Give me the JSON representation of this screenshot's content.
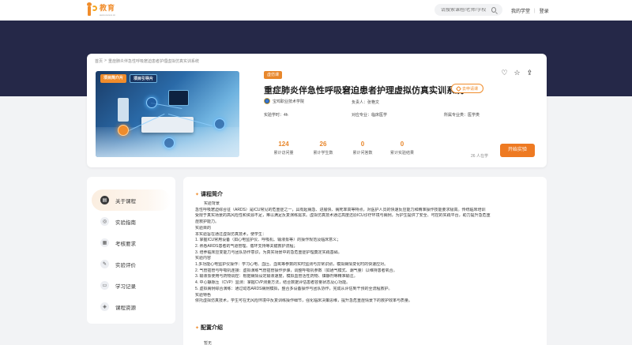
{
  "header": {
    "logo_title": "教育",
    "logo_subtitle": "www.xxxxxx.cn",
    "search_placeholder": "请搜索课程/老师/学校",
    "my_study": "我的学堂",
    "separator": "|",
    "login": "登录"
  },
  "breadcrumb": {
    "home": "首页",
    "arrow": ">",
    "current": "重症肺炎伴急性呼吸窘迫患者护理虚拟仿真实训系统"
  },
  "course": {
    "cover_tags": [
      "项目简介片",
      "项目引导片"
    ],
    "badge": "虚仿课",
    "title": "重症肺炎伴急性呼吸窘迫患者护理虚拟仿真实训系统",
    "apply_label": "去申请课",
    "school": "宝鸡职业技术学院",
    "owner": "负责人：张艳文",
    "hours": "实验学时：4h",
    "major": "对应专业：临床医学",
    "category": "所属专业类：医学类",
    "stats": [
      {
        "value": "124",
        "label": "累计访问量"
      },
      {
        "value": "26",
        "label": "累计学生数"
      },
      {
        "value": "0",
        "label": "累计问答数"
      },
      {
        "value": "0",
        "label": "累计实验结果"
      }
    ],
    "learners": "26 人在学",
    "start_label": "开始实验"
  },
  "side_nav": [
    {
      "label": "关于课程",
      "icon": "course-info-icon",
      "active": true
    },
    {
      "label": "实验指南",
      "icon": "compass-icon",
      "active": false
    },
    {
      "label": "考核要求",
      "icon": "clipboard-icon",
      "active": false
    },
    {
      "label": "实验评价",
      "icon": "pen-icon",
      "active": false
    },
    {
      "label": "学习记录",
      "icon": "book-icon",
      "active": false
    },
    {
      "label": "课程资源",
      "icon": "layers-icon",
      "active": false
    }
  ],
  "intro": {
    "title": "课程简介",
    "lines": [
      "实验背景",
      "急性呼吸窘迫综合征（ARDS）是ICU常见的危重症之一，具有起病急、进展快、病死率高等特点，对医护人员的快速反应能力和精准操作技能要求极高。传统临床培训",
      "受限于真实场景的高风险性和资源不足，难以满足反复演练需求。虚拟仿真技术通过高度还原ICU诊疗环境与病例，为护生提供了安全、可控的实践平台，助力提升急危重",
      "症救护能力。",
      "实验目的",
      "本实验旨在通过虚拟仿真技术，使学生：",
      "1. 掌握ICU常用设备（如心电监护仪、呼吸机、输液泵等）的操作规范及临床意义；",
      "2. 熟悉ARDS患者的气道管理、循环支持等关键救护流程；",
      "3. 培养临床应变能力与团队协作意识，为真实场景中的急危重症护理奠定实践基础。",
      "实验内容",
      "1.多功能心电监护仪操作：学习心电、血压、血氧等参数的实时监测与异常识别，模拟病情变化时的快速应对。",
      "2. 气管插管与呼吸机连接：虚拟演练气管插管操作步骤，调整呼吸机参数（如通气模式、潮气量）以维持患者氧合。",
      "3. 输液泵使用与药物调控：根据病情设定输液速度，模拟血管活性药物、镇静剂等精准输注。",
      "4. 中心静脉压（CVP）监测：掌握CVP测量方法，结合数据评估患者容量状态及心功能。",
      "5. 虚拟病例综合演练：通过动态ARDS病例模拟，整合多设备操作与团队协作，完成从评估到干预的全流程救护。",
      "实验特色",
      "依托虚拟仿真技术，学生可在无风险环境中反复训练操作细节，强化临床决策思维，提升急危重症情景下的救护效率与质量。"
    ]
  },
  "config": {
    "title": "配置介绍",
    "text": "暂无"
  }
}
